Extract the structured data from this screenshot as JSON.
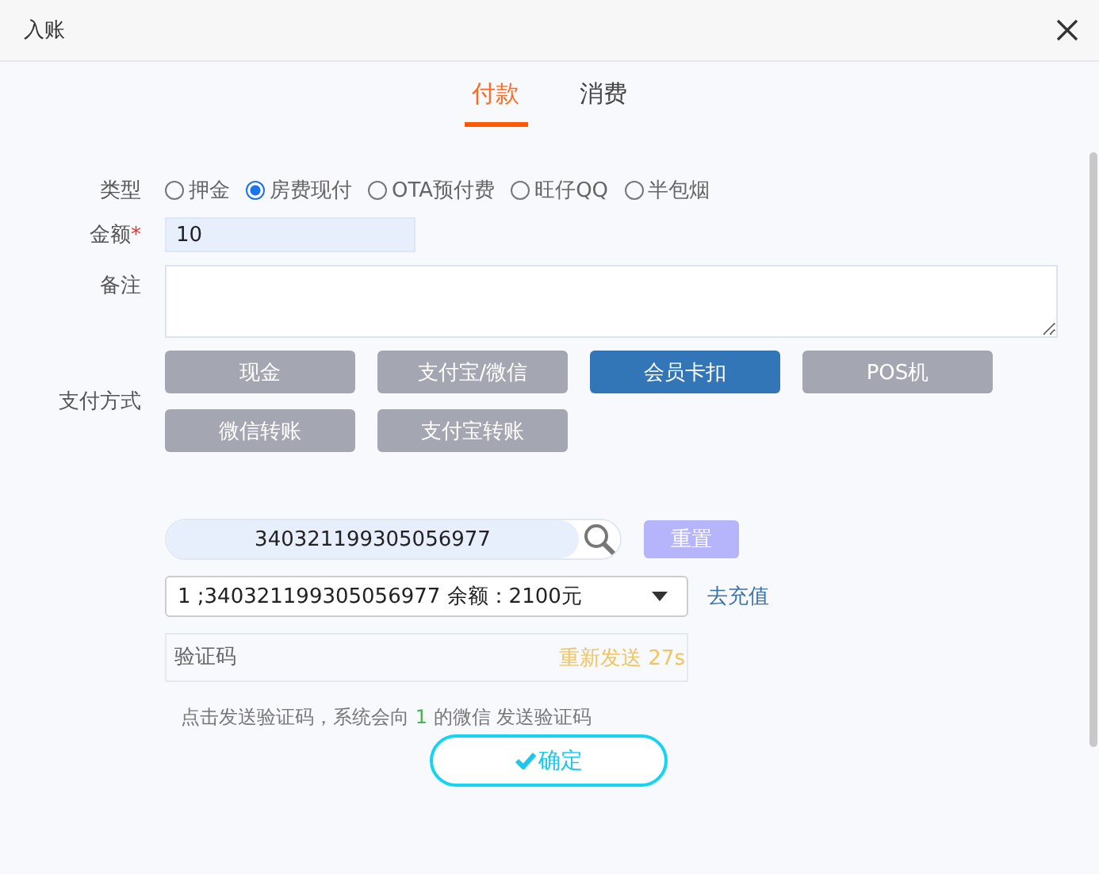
{
  "window": {
    "title": "入账"
  },
  "tabs": [
    {
      "label": "付款",
      "selected": true
    },
    {
      "label": "消费",
      "selected": false
    }
  ],
  "type": {
    "label": "类型",
    "options": [
      {
        "label": "押金",
        "selected": false
      },
      {
        "label": "房费现付",
        "selected": true
      },
      {
        "label": "OTA预付费",
        "selected": false
      },
      {
        "label": "旺仔QQ",
        "selected": false
      },
      {
        "label": "半包烟",
        "selected": false
      }
    ]
  },
  "amount": {
    "label": "金额",
    "required_mark": "*",
    "value": "10"
  },
  "remarks": {
    "label": "备注"
  },
  "payment": {
    "label": "支付方式",
    "methods": [
      {
        "label": "现金",
        "selected": false
      },
      {
        "label": "支付宝/微信",
        "selected": false
      },
      {
        "label": "会员卡扣",
        "selected": true
      },
      {
        "label": "POS机",
        "selected": false
      },
      {
        "label": "微信转账",
        "selected": false
      },
      {
        "label": "支付宝转账",
        "selected": false
      }
    ]
  },
  "search": {
    "value": "340321199305056977",
    "reset": "重置"
  },
  "card_select": {
    "value": "1 ;340321199305056977 余额：2100元",
    "recharge": "去充值"
  },
  "verify": {
    "placeholder": "验证码",
    "resend": "重新发送 27s"
  },
  "hint": {
    "before": "点击发送验证码，系统会向 ",
    "number": "1",
    "after": " 的微信 发送验证码"
  },
  "confirm": "确定"
}
